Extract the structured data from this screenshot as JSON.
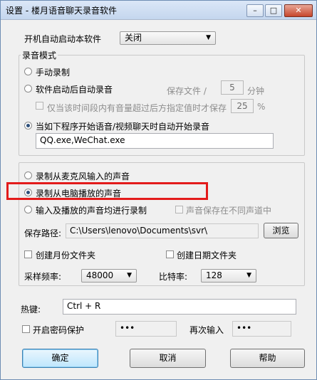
{
  "window": {
    "title": "设置 - 楼月语音聊天录音软件"
  },
  "autostart": {
    "label": "开机自动启动本软件",
    "value": "关闭"
  },
  "record_mode": {
    "group_label": "录音模式",
    "manual": "手动录制",
    "auto_on_start": "软件启动后自动录音",
    "save_every_label": "保存文件 /",
    "save_every_value": "5",
    "save_every_unit": "分钟",
    "volume_check_label": "仅当该时间段内有音量超过后方指定值时才保存",
    "volume_value": "25",
    "volume_unit": "%",
    "auto_on_chat": "当如下程序开始语音/视频聊天时自动开始录音",
    "programs": "QQ.exe,WeChat.exe"
  },
  "source": {
    "mic": "录制从麦克风输入的声音",
    "playback": "录制从电脑播放的声音",
    "both": "输入及播放的声音均进行录制",
    "separate_channels": "声音保存在不同声道中",
    "path_label": "保存路径:",
    "path_value": "C:\\Users\\lenovo\\Documents\\svr\\",
    "browse": "浏览",
    "monthly_folder": "创建月份文件夹",
    "daily_folder": "创建日期文件夹",
    "sample_rate_label": "采样频率:",
    "sample_rate": "48000",
    "bitrate_label": "比特率:",
    "bitrate": "128"
  },
  "hotkey": {
    "label": "热键:",
    "value": "Ctrl + R"
  },
  "password": {
    "enable": "开启密码保护",
    "value": "•••",
    "confirm_label": "再次输入",
    "confirm_value": "•••"
  },
  "buttons": {
    "ok": "确定",
    "cancel": "取消",
    "help": "帮助"
  },
  "icons": {
    "minimize": "–",
    "maximize": "□",
    "close": "✕",
    "dropdown": "▼"
  },
  "colors": {
    "highlight": "#e31b1b",
    "titlebar": "#c4d6ee"
  }
}
